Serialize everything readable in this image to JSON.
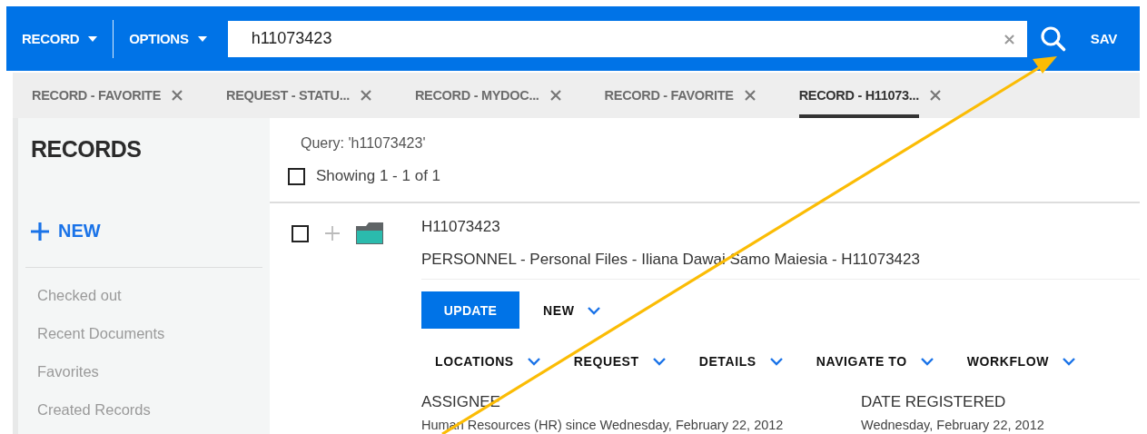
{
  "header": {
    "menus": [
      {
        "label": "RECORD"
      },
      {
        "label": "OPTIONS"
      }
    ],
    "search": {
      "value": "h11073423"
    },
    "save_label": "SAV"
  },
  "tabs": [
    {
      "label": "RECORD - FAVORITE",
      "selected": false
    },
    {
      "label": "REQUEST - STATU...",
      "selected": false
    },
    {
      "label": "RECORD - MYDOC...",
      "selected": false
    },
    {
      "label": "RECORD - FAVORITE",
      "selected": false
    },
    {
      "label": "RECORD - H11073...",
      "selected": true
    }
  ],
  "sidebar": {
    "title": "RECORDS",
    "new_label": "NEW",
    "items": [
      "Checked out",
      "Recent Documents",
      "Favorites",
      "Created Records"
    ]
  },
  "results": {
    "query": "Query: 'h11073423'",
    "select_all": {
      "checked": false
    },
    "summary": "Showing 1 - 1 of 1",
    "record": {
      "checked": false,
      "number": "H11073423",
      "title": "PERSONNEL - Personal Files - Iliana Dawai Samo Maiesia - H11073423",
      "primary_action": "UPDATE",
      "menus": [
        {
          "label": "NEW"
        }
      ],
      "toolbar": [
        {
          "label": "LOCATIONS"
        },
        {
          "label": "REQUEST"
        },
        {
          "label": "DETAILS"
        },
        {
          "label": "NAVIGATE TO"
        },
        {
          "label": "WORKFLOW"
        }
      ],
      "fields": [
        {
          "label": "ASSIGNEE",
          "value": "Human Resources (HR) since Wednesday, February 22, 2012"
        },
        {
          "label": "DATE REGISTERED",
          "value": "Wednesday, February 22, 2012"
        }
      ]
    }
  }
}
